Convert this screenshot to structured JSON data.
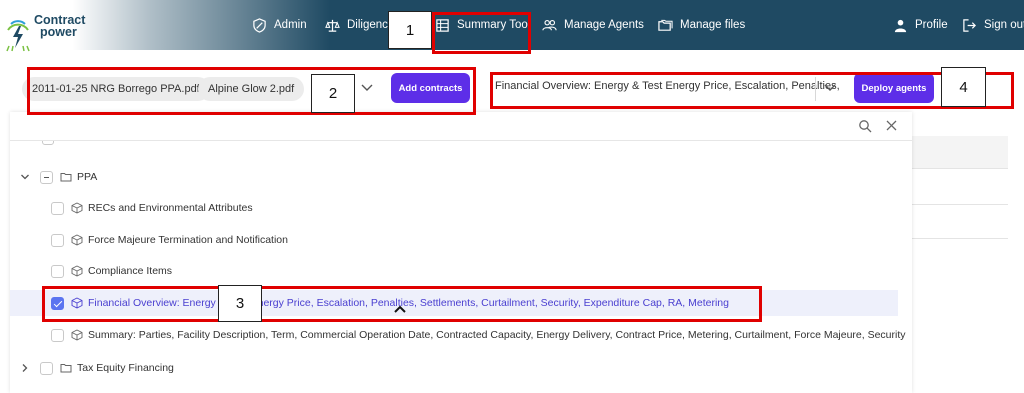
{
  "app": {
    "logo_top": "Contract",
    "logo_bottom": "power"
  },
  "nav": {
    "items": [
      {
        "label": "Admin",
        "icon": "shield-icon"
      },
      {
        "label": "Diligence",
        "icon": "scale-icon"
      },
      {
        "label": "Summary Tool",
        "icon": "table-icon"
      },
      {
        "label": "Manage Agents",
        "icon": "users-icon"
      },
      {
        "label": "Manage files",
        "icon": "folders-icon"
      }
    ],
    "profile_label": "Profile",
    "signout_label": "Sign out"
  },
  "contracts": {
    "chips": [
      "2011-01-25 NRG Borrego PPA.pdf",
      "Alpine Glow 2.pdf"
    ],
    "add_button": "Add contracts"
  },
  "agents": {
    "selected_value": "Financial Overview: Energy & Test Energy Price, Escalation, Penalties,",
    "deploy_button": "Deploy agents"
  },
  "tree": {
    "folder_ppa": "PPA",
    "items": [
      {
        "label": "RECs and Environmental Attributes",
        "checked": false
      },
      {
        "label": "Force Majeure Termination and Notification",
        "checked": false
      },
      {
        "label": "Compliance Items",
        "checked": false
      },
      {
        "label": "Financial Overview: Energy & Test Energy Price, Escalation, Penalties, Settlements, Curtailment, Security, Expenditure Cap, RA, Metering",
        "checked": true
      },
      {
        "label": "Summary: Parties, Facility Description, Term, Commercial Operation Date, Contracted Capacity, Energy Delivery, Contract Price, Metering, Curtailment, Force Majeure, Security",
        "checked": false
      }
    ],
    "folder_tax": "Tax Equity Financing"
  },
  "annotations": [
    "1",
    "2",
    "3",
    "4"
  ],
  "colors": {
    "nav_bg": "#1f4a63",
    "accent_purple": "#5d2ee8",
    "annotation_red": "#e00000",
    "checkbox_checked": "#5b74f0",
    "selected_text": "#4a3fd0"
  }
}
